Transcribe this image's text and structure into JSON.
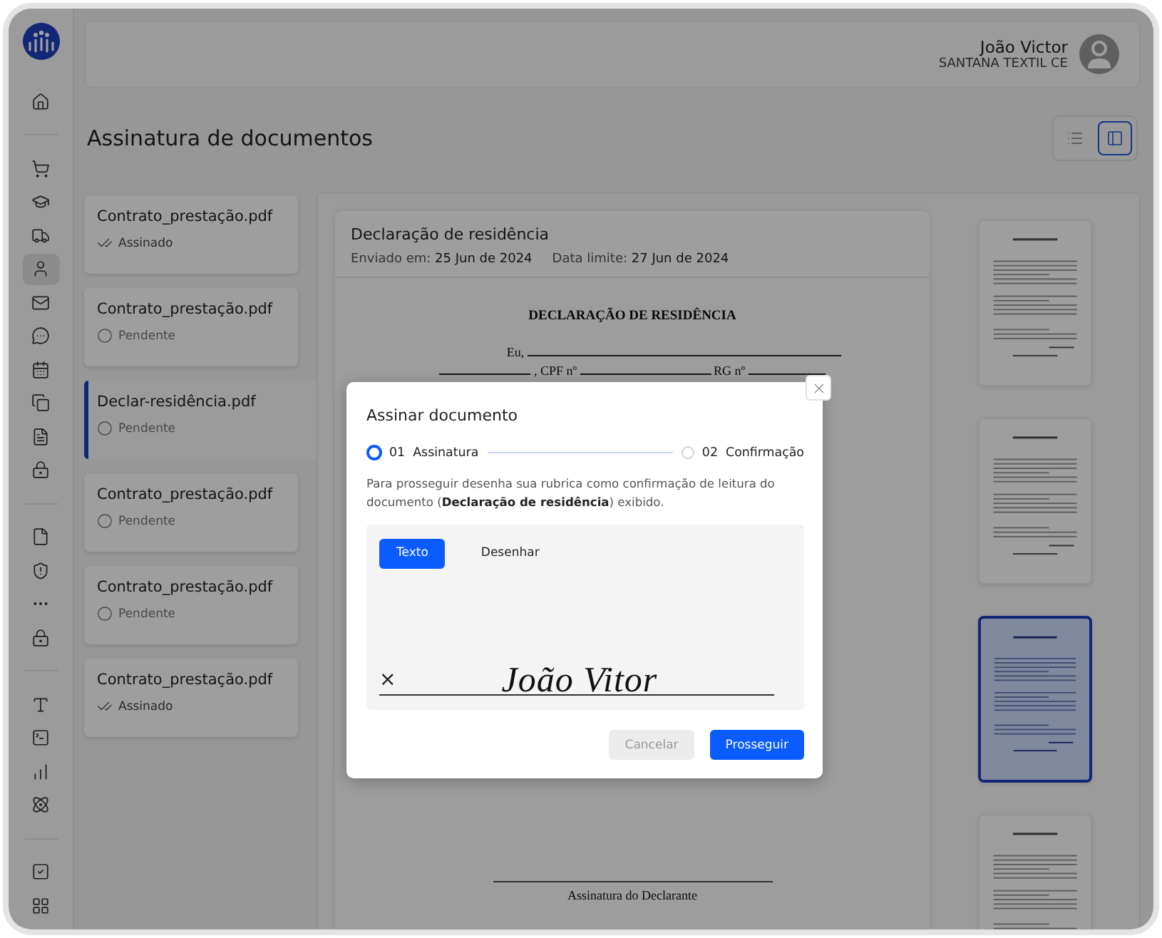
{
  "sidebar": {
    "groups": [
      {
        "items": [
          {
            "kind": "home",
            "selected": false
          }
        ]
      },
      {
        "items": [
          {
            "kind": "cart",
            "selected": false
          },
          {
            "kind": "cap",
            "selected": false
          },
          {
            "kind": "truck",
            "selected": false
          },
          {
            "kind": "user",
            "selected": true
          },
          {
            "kind": "mail",
            "selected": false
          },
          {
            "kind": "chat",
            "selected": false
          },
          {
            "kind": "calendar",
            "selected": false
          },
          {
            "kind": "copy",
            "selected": false
          },
          {
            "kind": "file-text",
            "selected": false
          },
          {
            "kind": "lock",
            "selected": false
          }
        ]
      },
      {
        "items": [
          {
            "kind": "file",
            "selected": false
          },
          {
            "kind": "shield",
            "selected": false
          },
          {
            "kind": "more",
            "selected": false
          },
          {
            "kind": "lock",
            "selected": false
          }
        ]
      },
      {
        "items": [
          {
            "kind": "type",
            "selected": false
          },
          {
            "kind": "terminal",
            "selected": false
          },
          {
            "kind": "chart",
            "selected": false
          },
          {
            "kind": "atom",
            "selected": false
          }
        ]
      },
      {
        "items": [
          {
            "kind": "check",
            "selected": false
          },
          {
            "kind": "grid",
            "selected": false
          }
        ]
      }
    ]
  },
  "header": {
    "user_name": "João Victor",
    "company": "SANTANA TEXTIL CE"
  },
  "page_title": "Assinatura de documentos",
  "view_toggle": [
    {
      "kind": "list",
      "selected": false
    },
    {
      "kind": "panel",
      "selected": true
    }
  ],
  "documents": [
    {
      "name": "Contrato_prestação.pdf",
      "status": {
        "kind": "signed",
        "label": "Assinado"
      },
      "selected": false
    },
    {
      "name": "Contrato_prestação.pdf",
      "status": {
        "kind": "pending",
        "label": "Pendente"
      },
      "selected": false
    },
    {
      "name": "Declar-residência.pdf",
      "status": {
        "kind": "pending",
        "label": "Pendente"
      },
      "selected": true
    },
    {
      "name": "Contrato_prestação.pdf",
      "status": {
        "kind": "pending",
        "label": "Pendente"
      },
      "selected": false
    },
    {
      "name": "Contrato_prestação.pdf",
      "status": {
        "kind": "pending",
        "label": "Pendente"
      },
      "selected": false
    },
    {
      "name": "Contrato_prestação.pdf",
      "status": {
        "kind": "signed",
        "label": "Assinado"
      },
      "selected": false
    }
  ],
  "viewer": {
    "title": "Declaração de residência",
    "meta": [
      {
        "label": "Enviado em:",
        "value": "25 Jun de 2024"
      },
      {
        "label": "Data limite:",
        "value": "27 Jun de 2024"
      }
    ],
    "page": {
      "heading": "DECLARAÇÃO DE RESIDÊNCIA",
      "line_1": "Eu,",
      "line_2_parts": [
        ", CPF nº",
        "RG nº"
      ],
      "signature_caption": "Assinatura do Declarante"
    }
  },
  "thumbnails": [
    {
      "selected": false
    },
    {
      "selected": false
    },
    {
      "selected": true
    },
    {
      "selected": false
    }
  ],
  "modal": {
    "title": "Assinar documento",
    "steps": [
      {
        "number": "01",
        "label": "Assinatura",
        "selected": true
      },
      {
        "number": "02",
        "label": "Confirmação",
        "selected": false
      }
    ],
    "description": "Para prosseguir desenha sua rubrica como confirmação de leitura do documento (**Declaração de residência**) exibido.",
    "mode_tabs": [
      {
        "label": "Texto",
        "selected": true
      },
      {
        "label": "Desenhar",
        "selected": false
      }
    ],
    "signature": {
      "mark": "×",
      "text": "João Vitor"
    },
    "buttons": [
      {
        "label": "Cancelar",
        "kind": "secondary",
        "disabled": true
      },
      {
        "label": "Prosseguir",
        "kind": "primary",
        "disabled": false
      }
    ]
  }
}
